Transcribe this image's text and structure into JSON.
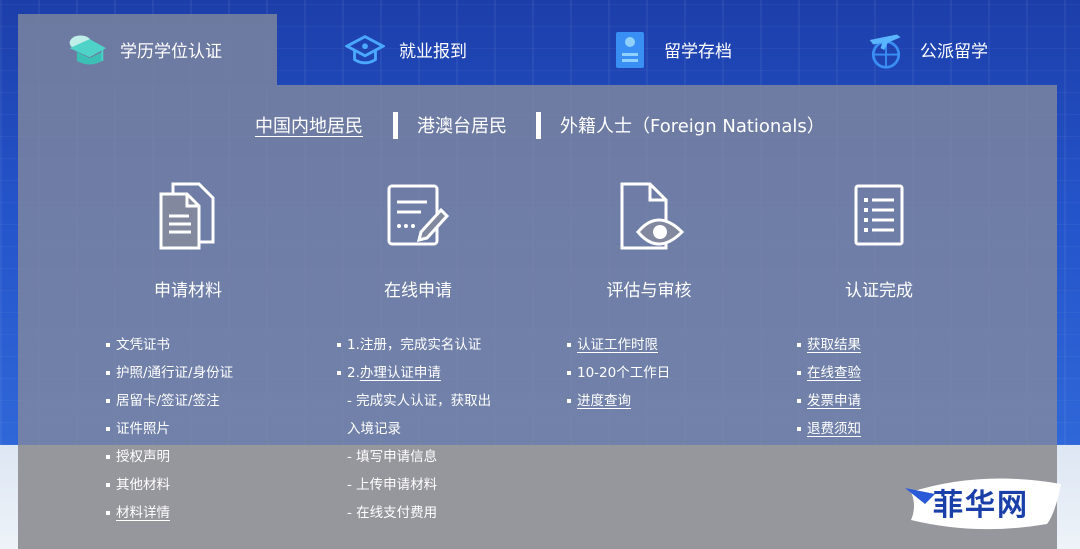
{
  "tabs": [
    {
      "label": "学历学位认证",
      "icon": "graduation-cap-icon",
      "active": true
    },
    {
      "label": "就业报到",
      "icon": "cap-outline-icon",
      "active": false
    },
    {
      "label": "留学存档",
      "icon": "document-archive-icon",
      "active": false
    },
    {
      "label": "公派留学",
      "icon": "plane-globe-icon",
      "active": false
    }
  ],
  "categories": [
    {
      "label": "中国内地居民",
      "active": true
    },
    {
      "label": "港澳台居民",
      "active": false
    },
    {
      "label": "外籍人士（Foreign Nationals）",
      "active": false
    }
  ],
  "steps": [
    {
      "label": "申请材料",
      "icon": "documents-icon"
    },
    {
      "label": "在线申请",
      "icon": "form-edit-icon"
    },
    {
      "label": "评估与审核",
      "icon": "file-eye-icon"
    },
    {
      "label": "认证完成",
      "icon": "checklist-icon"
    }
  ],
  "columns": {
    "materials": [
      "文凭证书",
      "护照/通行证/身份证",
      "居留卡/签证/签注",
      "证件照片",
      "授权声明",
      "其他材料",
      "材料详情"
    ],
    "online": {
      "step1": "1.注册，完成实名认证",
      "step2_prefix": "2.",
      "step2_link": "办理认证申请",
      "sub1a": "- 完成实人认证，获取出",
      "sub1b": "入境记录",
      "sub2": "- 填写申请信息",
      "sub3": "- 上传申请材料",
      "sub4": "- 在线支付费用"
    },
    "review": {
      "link1": "认证工作时限",
      "text1": "10-20个工作日",
      "link2": "进度查询"
    },
    "complete": [
      "获取结果",
      "在线查验",
      "发票申请",
      "退费须知"
    ]
  },
  "watermark": "菲华网",
  "colors": {
    "accent": "#2453c9",
    "tab_icon_active": "#4fd3c8",
    "tab_icon": "#4aa8ff",
    "panel": "#82889e"
  }
}
